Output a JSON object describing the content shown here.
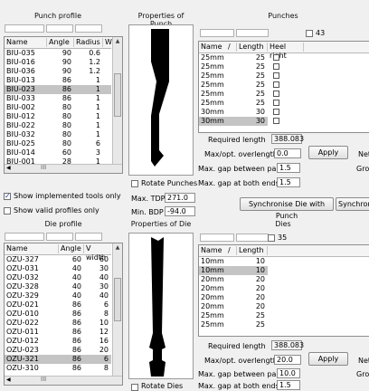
{
  "punch_profile": {
    "title": "Punch profile",
    "columns": [
      "Name",
      "Angle",
      "Radius",
      "W"
    ],
    "rows": [
      [
        "BIU-035",
        "90",
        "0.6"
      ],
      [
        "BIU-016",
        "90",
        "1.2"
      ],
      [
        "BIU-036",
        "90",
        "1.2"
      ],
      [
        "BIU-013",
        "86",
        "1"
      ],
      [
        "BIU-023",
        "86",
        "1"
      ],
      [
        "BIU-033",
        "86",
        "1"
      ],
      [
        "BIU-002",
        "80",
        "1"
      ],
      [
        "BIU-012",
        "80",
        "1"
      ],
      [
        "BIU-022",
        "80",
        "1"
      ],
      [
        "BIU-032",
        "80",
        "1"
      ],
      [
        "BIU-025",
        "80",
        "6"
      ],
      [
        "BIU-014",
        "60",
        "3"
      ],
      [
        "BIU-001",
        "28",
        "1"
      ]
    ],
    "selected_index": 4,
    "show_implemented_label": "Show implemented tools only",
    "show_implemented_checked": true,
    "show_valid_label": "Show valid profiles only",
    "show_valid_checked": false,
    "scroll_label": "III"
  },
  "properties_punch": {
    "title": "Properties of Punch",
    "rotate_label": "Rotate Punches",
    "max_tdp_label": "Max. TDP",
    "max_tdp_value": "271.0",
    "min_bdp_label": "Min. BDP",
    "min_bdp_value": "-94.0"
  },
  "punches": {
    "title": "Punches",
    "count": "43",
    "columns": [
      "Name",
      "/",
      "Length",
      "Heel right"
    ],
    "rows": [
      [
        "25mm",
        "25"
      ],
      [
        "25mm",
        "25"
      ],
      [
        "25mm",
        "25"
      ],
      [
        "25mm",
        "25"
      ],
      [
        "25mm",
        "25"
      ],
      [
        "25mm",
        "25"
      ],
      [
        "30mm",
        "30"
      ],
      [
        "30mm",
        "30"
      ]
    ],
    "selected_index": 7,
    "required_length_label": "Required length",
    "required_length_value": "388.083",
    "max_overlength_label": "Max/opt. overlength",
    "max_overlength_value": "0.0",
    "apply_label": "Apply",
    "net_label": "Net",
    "max_gap_parts_label": "Max. gap between parts",
    "max_gap_parts_value": "1.5",
    "gross_label": "Gros",
    "max_gap_ends_label": "Max. gap at both ends",
    "max_gap_ends_value": "1.5",
    "sync_die_label": "Synchronise Die with Punch",
    "sync_label": "Synchroni"
  },
  "die_profile": {
    "title": "Die profile",
    "columns": [
      "Name",
      "Angle",
      "V width"
    ],
    "rows": [
      [
        "OZU-327",
        "60",
        "60"
      ],
      [
        "OZU-031",
        "40",
        "30"
      ],
      [
        "OZU-032",
        "40",
        "40"
      ],
      [
        "OZU-328",
        "40",
        "30"
      ],
      [
        "OZU-329",
        "40",
        "40"
      ],
      [
        "OZU-021",
        "86",
        "6"
      ],
      [
        "OZU-010",
        "86",
        "8"
      ],
      [
        "OZU-022",
        "86",
        "10"
      ],
      [
        "OZU-011",
        "86",
        "12"
      ],
      [
        "OZU-012",
        "86",
        "16"
      ],
      [
        "OZU-023",
        "86",
        "20"
      ],
      [
        "OZU-321",
        "86",
        "6"
      ],
      [
        "OZU-310",
        "86",
        "8"
      ]
    ],
    "selected_index": 11,
    "scroll_label": "III"
  },
  "properties_die": {
    "title": "Properties of Die",
    "rotate_label": "Rotate Dies"
  },
  "dies": {
    "title": "Dies",
    "count": "35",
    "columns": [
      "Name",
      "/",
      "Length"
    ],
    "rows": [
      [
        "10mm",
        "10"
      ],
      [
        "10mm",
        "10"
      ],
      [
        "20mm",
        "20"
      ],
      [
        "20mm",
        "20"
      ],
      [
        "20mm",
        "20"
      ],
      [
        "20mm",
        "20"
      ],
      [
        "25mm",
        "25"
      ],
      [
        "25mm",
        "25"
      ]
    ],
    "selected_index": 1,
    "required_length_label": "Required length",
    "required_length_value": "388.083",
    "max_overlength_label": "Max/opt. overlength",
    "max_overlength_value": "20.0",
    "apply_label": "Apply",
    "net_label": "Net",
    "max_gap_parts_label": "Max. gap between parts",
    "max_gap_parts_value": "10.0",
    "gross_label": "Gros",
    "max_gap_ends_label": "Max. gap at both ends",
    "max_gap_ends_value": "1.5"
  }
}
